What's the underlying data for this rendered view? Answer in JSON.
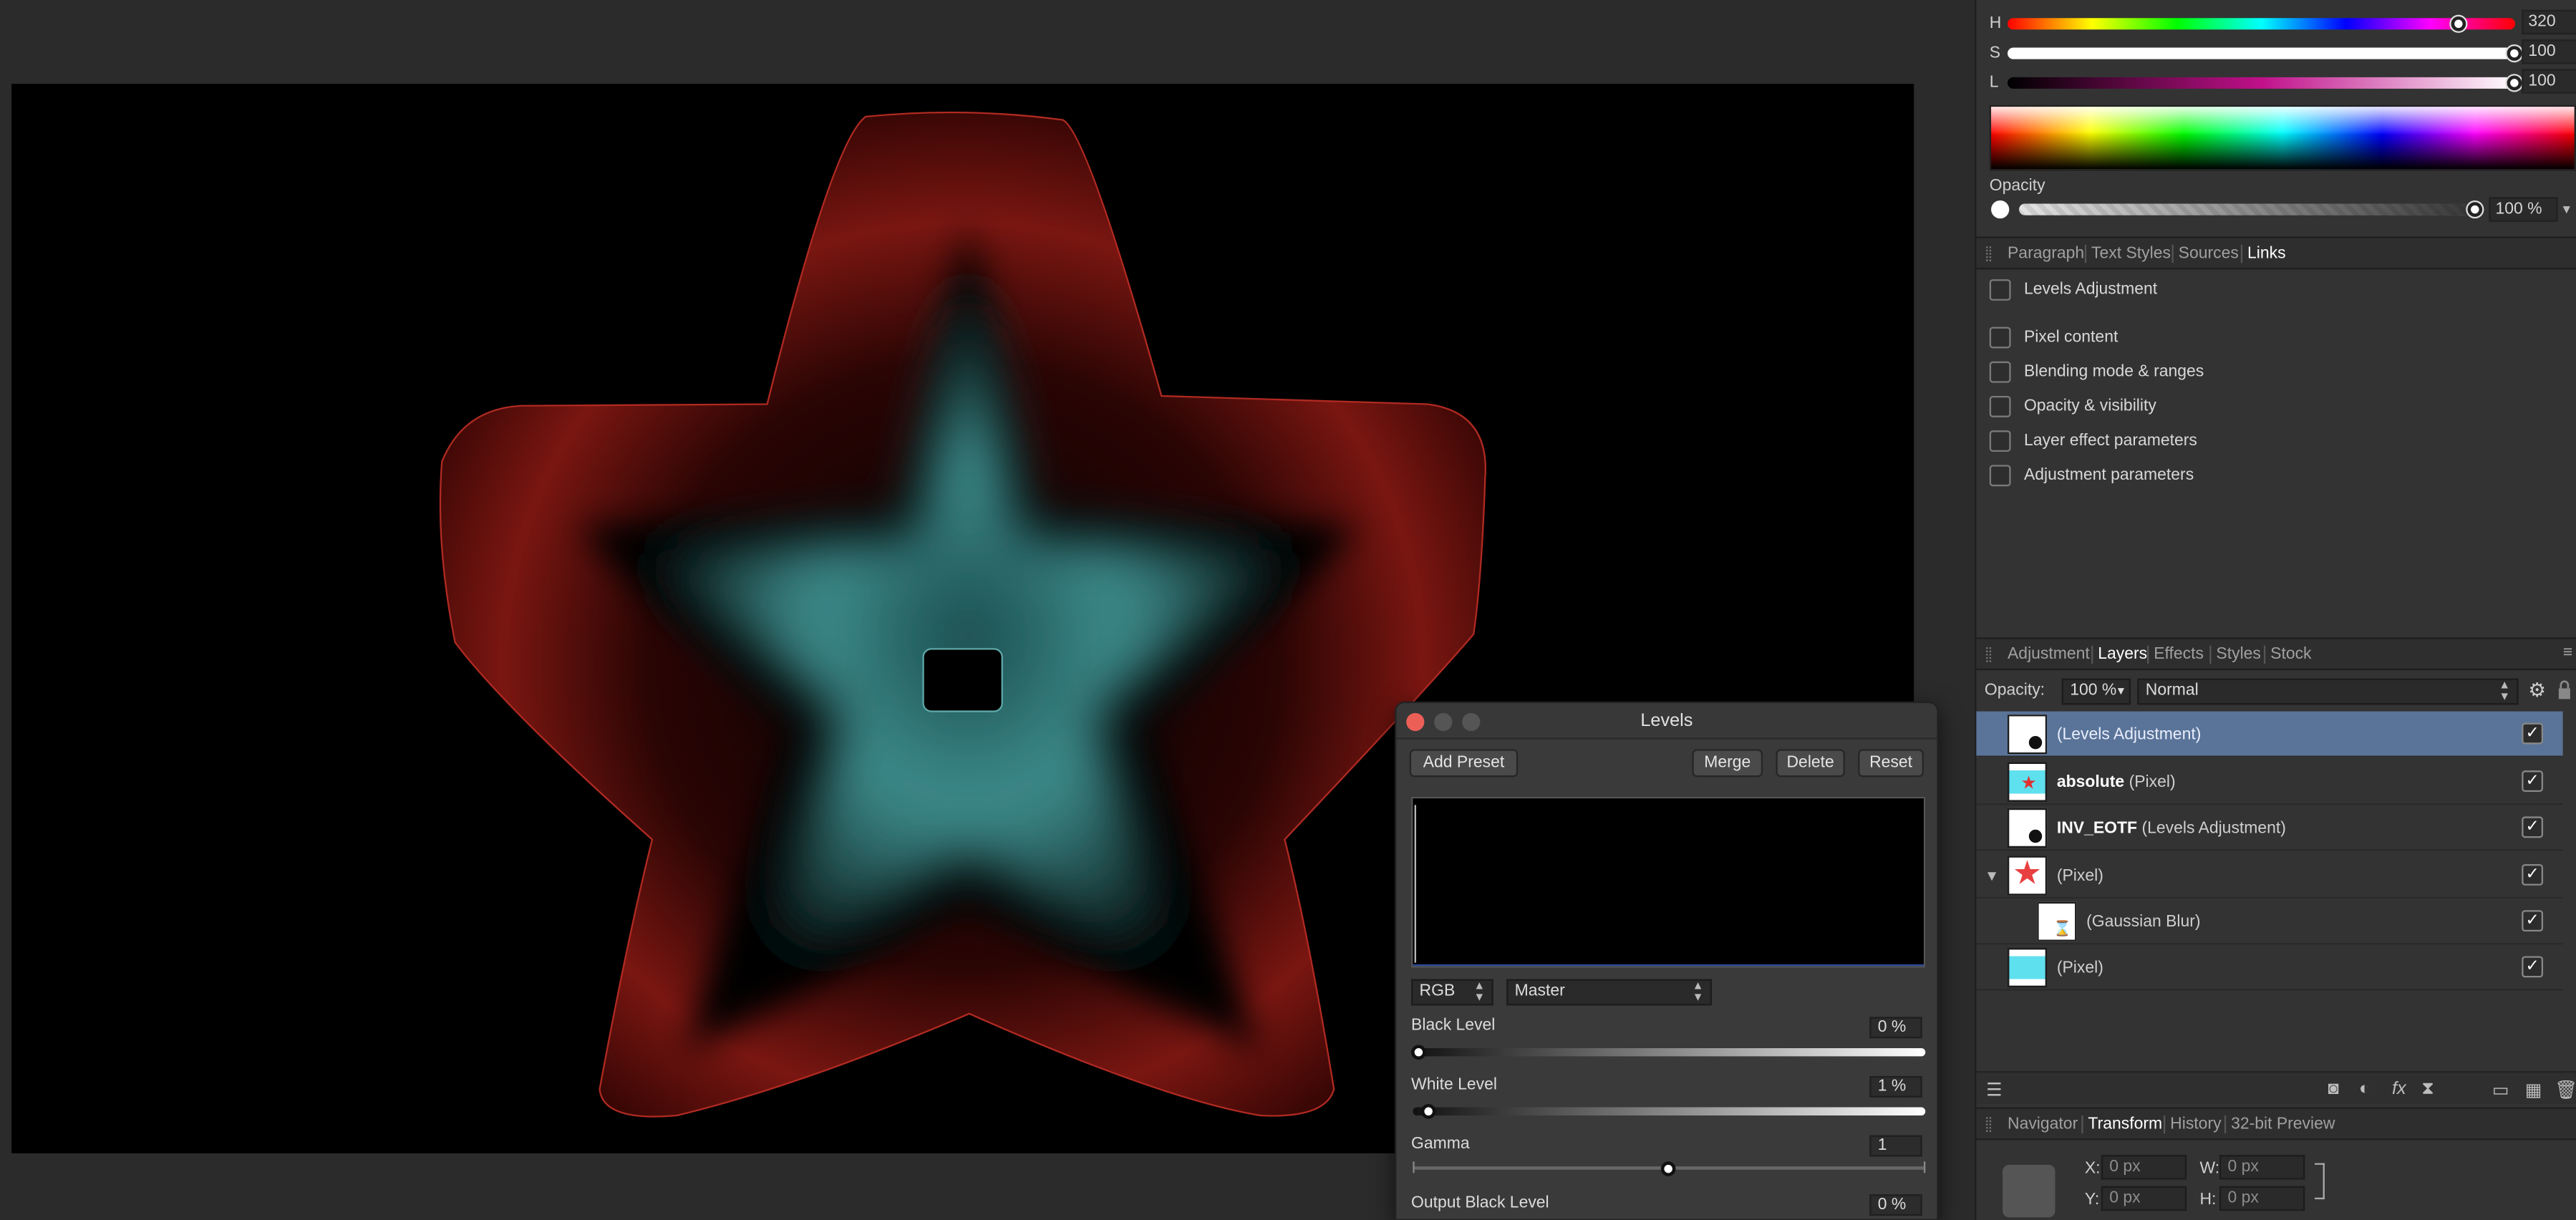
{
  "color": {
    "h_label": "H",
    "h_value": "320",
    "s_label": "S",
    "s_value": "100",
    "l_label": "L",
    "l_value": "100",
    "opacity_label": "Opacity",
    "opacity_value": "100 %",
    "h_fraction": 0.889,
    "s_fraction": 1.0,
    "l_fraction": 1.0,
    "opacity_fraction": 1.0
  },
  "top_tabs": {
    "items": [
      "Paragraph",
      "Text Styles",
      "Sources",
      "Links"
    ],
    "active": "Links"
  },
  "links": {
    "header": "Levels Adjustment",
    "items": [
      "Pixel content",
      "Blending mode & ranges",
      "Opacity & visibility",
      "Layer effect parameters",
      "Adjustment parameters"
    ]
  },
  "layer_tabs": {
    "items": [
      "Adjustment",
      "Layers",
      "Effects",
      "Styles",
      "Stock"
    ],
    "active": "Layers"
  },
  "layers_toolbar": {
    "opacity_label": "Opacity:",
    "opacity_value": "100 %",
    "blend_mode": "Normal"
  },
  "layers": [
    {
      "bold": "",
      "name": "(Levels Adjustment)",
      "selected": true,
      "checked": "✓"
    },
    {
      "bold": "absolute",
      "name": "(Pixel)",
      "selected": false,
      "checked": "✓"
    },
    {
      "bold": "INV_EOTF",
      "name": "(Levels Adjustment)",
      "selected": false,
      "checked": "✓"
    },
    {
      "bold": "",
      "name": "(Pixel)",
      "selected": false,
      "checked": "✓"
    },
    {
      "bold": "",
      "name": "(Gaussian Blur)",
      "selected": false,
      "checked": "✓"
    },
    {
      "bold": "",
      "name": "(Pixel)",
      "selected": false,
      "checked": "✓"
    }
  ],
  "bottom_tabs": {
    "items": [
      "Navigator",
      "Transform",
      "History",
      "32-bit Preview"
    ],
    "active": "Transform"
  },
  "transform": {
    "x_label": "X:",
    "x_value": "0 px",
    "y_label": "Y:",
    "y_value": "0 px",
    "w_label": "W:",
    "w_value": "0 px",
    "h_label": "H:",
    "h_value": "0 px"
  },
  "levels_dialog": {
    "title": "Levels",
    "add_preset": "Add Preset",
    "merge": "Merge",
    "delete": "Delete",
    "reset": "Reset",
    "channel": "RGB",
    "mode": "Master",
    "black_level_label": "Black Level",
    "black_level_value": "0 %",
    "black_level_fraction": 0.0,
    "white_level_label": "White Level",
    "white_level_value": "1 %",
    "white_level_fraction": 0.01,
    "gamma_label": "Gamma",
    "gamma_value": "1",
    "gamma_fraction": 0.5,
    "output_black_label": "Output Black Level",
    "output_black_value": "0 %"
  },
  "colors": {
    "selection": "#5a7398",
    "star_outer": "#8a1a14",
    "star_inner": "#3c8c8c"
  }
}
